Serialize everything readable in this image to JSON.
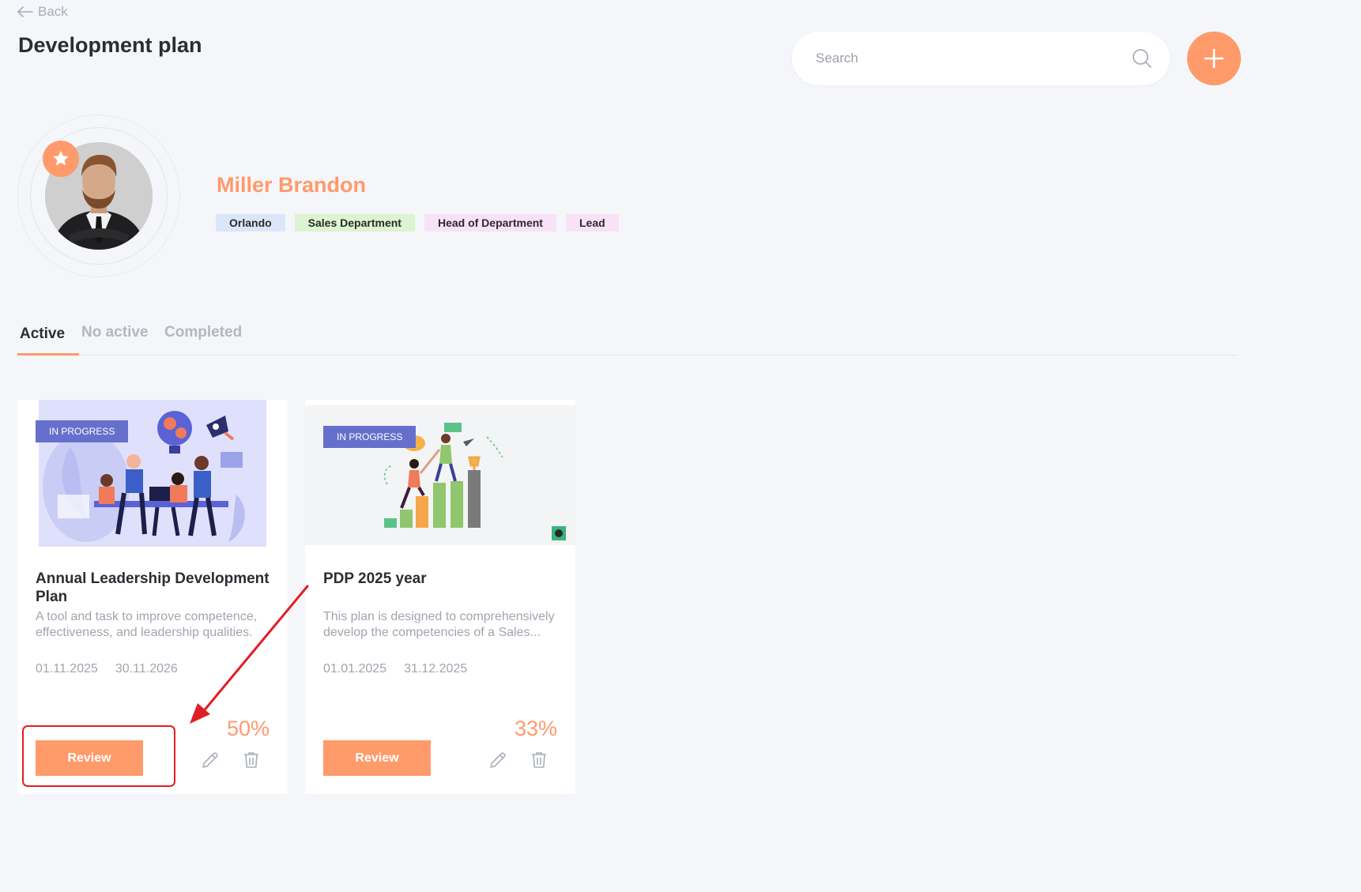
{
  "nav": {
    "back_label": "Back"
  },
  "header": {
    "title": "Development plan",
    "search_placeholder": "Search",
    "add_icon": "plus-icon"
  },
  "profile": {
    "name": "Miller Brandon",
    "tags": [
      "Orlando",
      "Sales Department",
      "Head of Department",
      "Lead"
    ],
    "badge_icon": "star-icon"
  },
  "tabs": [
    {
      "label": "Active",
      "selected": true
    },
    {
      "label": "No active",
      "selected": false
    },
    {
      "label": "Completed",
      "selected": false
    }
  ],
  "cards": [
    {
      "status": "IN PROGRESS",
      "title": "Annual Leadership Development Plan",
      "description": "A tool and task to improve competence, effectiveness, and leadership qualities.",
      "start_date": "01.11.2025",
      "end_date": "30.11.2026",
      "progress": "50%",
      "review_label": "Review",
      "highlighted": true
    },
    {
      "status": "IN PROGRESS",
      "title": "PDP 2025 year",
      "description": "This plan is designed to comprehensively develop the competencies of a Sales...",
      "start_date": "01.01.2025",
      "end_date": "31.12.2025",
      "progress": "33%",
      "review_label": "Review",
      "highlighted": false
    }
  ],
  "colors": {
    "accent": "#ff9a6b",
    "badge": "#6670cc",
    "annotation": "#e11d24",
    "background": "#f5f6f9"
  }
}
